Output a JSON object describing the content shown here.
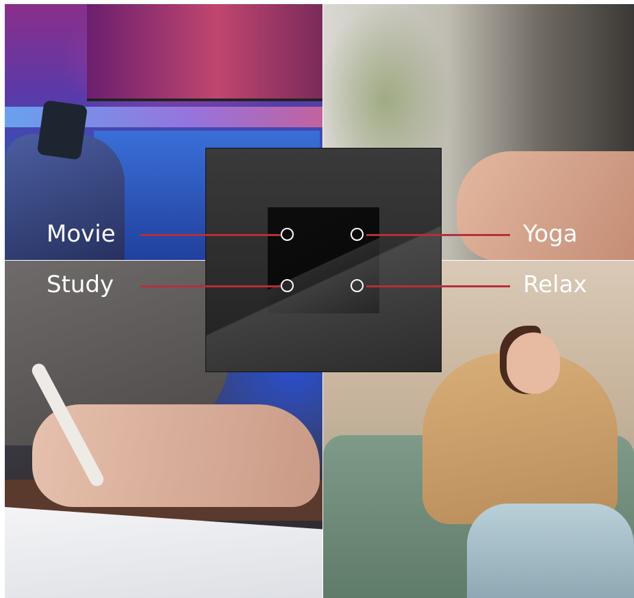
{
  "scenes": {
    "movie": {
      "label": "Movie"
    },
    "yoga": {
      "label": "Yoga"
    },
    "study": {
      "label": "Study"
    },
    "relax": {
      "label": "Relax"
    }
  },
  "colors": {
    "leader_line": "#b52f3a",
    "button_ring": "#ffffff",
    "label_text": "#ffffff"
  }
}
